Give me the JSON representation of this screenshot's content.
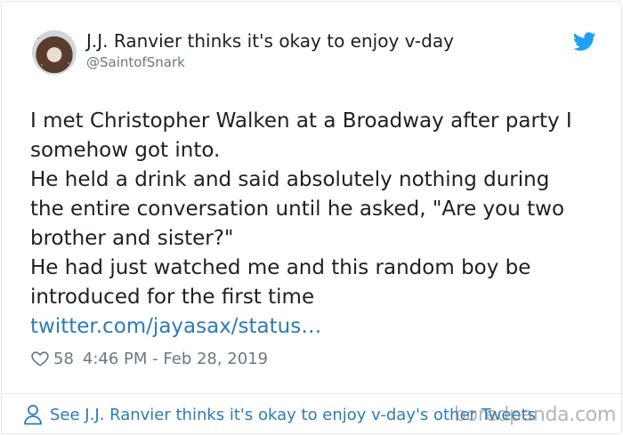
{
  "author": {
    "display_name": "J.J. Ranvier thinks it's okay to enjoy v-day",
    "handle": "@SaintofSnark"
  },
  "tweet": {
    "lines": [
      "I met Christopher Walken at a Broadway after party I",
      "somehow got into.",
      "He held a drink and said absolutely nothing during",
      "the entire conversation until he asked, \"Are you two",
      "brother and sister?\"",
      "He had just watched me and this random boy be",
      "introduced for the first time"
    ],
    "link": "twitter.com/jayasax/status…"
  },
  "meta": {
    "likes": "58",
    "timestamp": "4:46 PM - Feb 28, 2019"
  },
  "footer": {
    "label": "See J.J. Ranvier thinks it's okay to enjoy v-day's other Tweets"
  },
  "watermark": "boredpanda.com",
  "colors": {
    "text": "#1c2022",
    "muted": "#697882",
    "link": "#2b7bb9",
    "twitter_blue": "#1da1f2",
    "border": "#e1e8ed"
  },
  "icons": [
    "avatar",
    "twitter-bird-icon",
    "heart-icon",
    "person-icon"
  ]
}
